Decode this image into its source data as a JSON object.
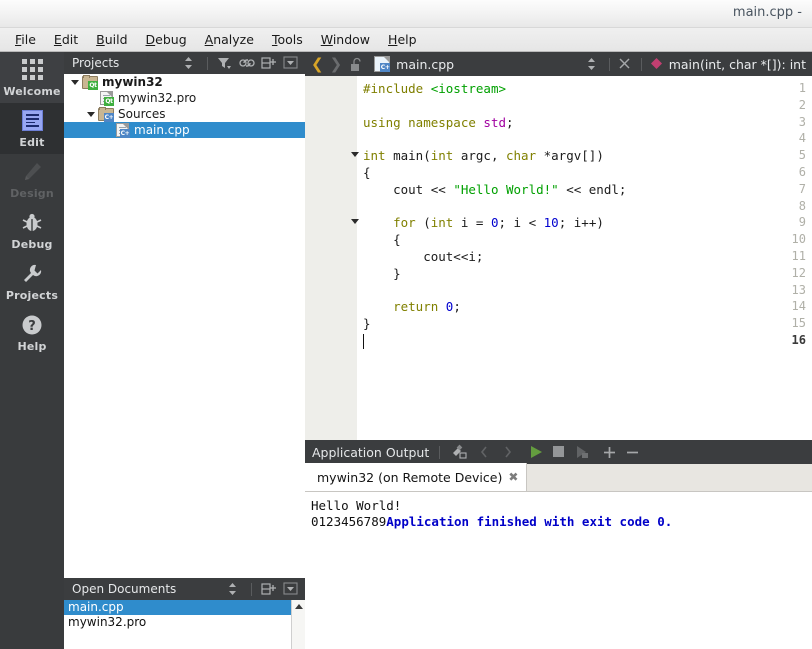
{
  "window": {
    "title": "main.cpp -"
  },
  "menubar": {
    "items": [
      {
        "label": "File",
        "mnemonic": "F"
      },
      {
        "label": "Edit",
        "mnemonic": "E"
      },
      {
        "label": "Build",
        "mnemonic": "B"
      },
      {
        "label": "Debug",
        "mnemonic": "D"
      },
      {
        "label": "Analyze",
        "mnemonic": "A"
      },
      {
        "label": "Tools",
        "mnemonic": "T"
      },
      {
        "label": "Window",
        "mnemonic": "W"
      },
      {
        "label": "Help",
        "mnemonic": "H"
      }
    ]
  },
  "modebar": {
    "items": [
      {
        "label": "Welcome",
        "icon": "grid-icon",
        "state": "normal"
      },
      {
        "label": "Edit",
        "icon": "document-edit-icon",
        "state": "active"
      },
      {
        "label": "Design",
        "icon": "pencil-icon",
        "state": "disabled"
      },
      {
        "label": "Debug",
        "icon": "bug-icon",
        "state": "normal"
      },
      {
        "label": "Projects",
        "icon": "wrench-icon",
        "state": "normal"
      },
      {
        "label": "Help",
        "icon": "question-mark-icon",
        "state": "normal"
      }
    ]
  },
  "projects_panel": {
    "title": "Projects",
    "tools": [
      "sort-selector-icon",
      "filter-icon",
      "link-icon",
      "split-add-icon",
      "close-dropdown-icon"
    ],
    "tree": [
      {
        "label": "mywin32",
        "icon": "qt-folder-icon",
        "depth": 0,
        "expanded": true,
        "bold": true,
        "selected": false
      },
      {
        "label": "mywin32.pro",
        "icon": "qt-file-icon",
        "depth": 1,
        "expanded": false,
        "bold": false,
        "selected": false
      },
      {
        "label": "Sources",
        "icon": "cpp-folder-icon",
        "depth": 1,
        "expanded": true,
        "bold": false,
        "selected": false
      },
      {
        "label": "main.cpp",
        "icon": "cpp-file-icon",
        "depth": 2,
        "expanded": false,
        "bold": false,
        "selected": true
      }
    ]
  },
  "open_documents": {
    "title": "Open Documents",
    "tools": [
      "sort-selector-icon",
      "split-add-icon",
      "close-dropdown-icon"
    ],
    "items": [
      {
        "label": "main.cpp",
        "selected": true
      },
      {
        "label": "mywin32.pro",
        "selected": false
      }
    ]
  },
  "editor_toolbar": {
    "back_icon": "chevron-left-icon",
    "forward_icon": "chevron-right-icon",
    "lock_icon": "unlocked-icon",
    "file_icon": "cpp-file-icon",
    "filename": "main.cpp",
    "selector_icon": "updown-selector-icon",
    "close_icon": "close-x-icon",
    "symbol_icon": "function-diamond-icon",
    "symbol": "main(int, char *[]): int"
  },
  "code": {
    "cursor_line": 16,
    "lines": [
      {
        "n": 1,
        "fold": false,
        "tokens": [
          {
            "t": "#include ",
            "c": "pre"
          },
          {
            "t": "<iostream>",
            "c": "str"
          }
        ]
      },
      {
        "n": 2,
        "fold": false,
        "tokens": []
      },
      {
        "n": 3,
        "fold": false,
        "tokens": [
          {
            "t": "using namespace ",
            "c": "kw"
          },
          {
            "t": "std",
            "c": "ns"
          },
          {
            "t": ";",
            "c": "op"
          }
        ]
      },
      {
        "n": 4,
        "fold": false,
        "tokens": []
      },
      {
        "n": 5,
        "fold": true,
        "tokens": [
          {
            "t": "int",
            "c": "kw"
          },
          {
            "t": " main(",
            "c": "op"
          },
          {
            "t": "int",
            "c": "kw"
          },
          {
            "t": " argc, ",
            "c": "op"
          },
          {
            "t": "char",
            "c": "kw"
          },
          {
            "t": " *argv[])",
            "c": "op"
          }
        ]
      },
      {
        "n": 6,
        "fold": false,
        "tokens": [
          {
            "t": "{",
            "c": "op"
          }
        ]
      },
      {
        "n": 7,
        "fold": false,
        "tokens": [
          {
            "t": "    cout << ",
            "c": "op"
          },
          {
            "t": "\"Hello World!\"",
            "c": "str"
          },
          {
            "t": " << endl;",
            "c": "op"
          }
        ]
      },
      {
        "n": 8,
        "fold": false,
        "tokens": []
      },
      {
        "n": 9,
        "fold": true,
        "tokens": [
          {
            "t": "    ",
            "c": "op"
          },
          {
            "t": "for",
            "c": "kw"
          },
          {
            "t": " (",
            "c": "op"
          },
          {
            "t": "int",
            "c": "kw"
          },
          {
            "t": " i = ",
            "c": "op"
          },
          {
            "t": "0",
            "c": "num"
          },
          {
            "t": "; i < ",
            "c": "op"
          },
          {
            "t": "10",
            "c": "num"
          },
          {
            "t": "; i++)",
            "c": "op"
          }
        ]
      },
      {
        "n": 10,
        "fold": false,
        "tokens": [
          {
            "t": "    {",
            "c": "op"
          }
        ]
      },
      {
        "n": 11,
        "fold": false,
        "tokens": [
          {
            "t": "        cout<<i;",
            "c": "op"
          }
        ]
      },
      {
        "n": 12,
        "fold": false,
        "tokens": [
          {
            "t": "    }",
            "c": "op"
          }
        ]
      },
      {
        "n": 13,
        "fold": false,
        "tokens": []
      },
      {
        "n": 14,
        "fold": false,
        "tokens": [
          {
            "t": "    ",
            "c": "op"
          },
          {
            "t": "return",
            "c": "kw"
          },
          {
            "t": " ",
            "c": "op"
          },
          {
            "t": "0",
            "c": "num"
          },
          {
            "t": ";",
            "c": "op"
          }
        ]
      },
      {
        "n": 15,
        "fold": false,
        "tokens": [
          {
            "t": "}",
            "c": "op"
          }
        ]
      },
      {
        "n": 16,
        "fold": false,
        "tokens": []
      }
    ]
  },
  "output_pane": {
    "title": "Application Output",
    "tools": [
      "clear-output-icon",
      "prev-item-icon",
      "next-item-icon",
      "run-icon",
      "stop-icon",
      "attach-icon",
      "zoom-in-icon",
      "zoom-out-icon"
    ],
    "tab": {
      "label": "mywin32 (on Remote Device)",
      "close_icon": "close-x-icon"
    },
    "lines": [
      {
        "segments": [
          {
            "t": "Hello World!",
            "c": "plain"
          }
        ]
      },
      {
        "segments": [
          {
            "t": "0123456789",
            "c": "plain"
          },
          {
            "t": "Application finished with exit code 0.",
            "c": "blue"
          }
        ]
      }
    ]
  },
  "colors": {
    "accent_selection": "#2f8ccc",
    "dark_chrome": "#3b3d3f",
    "mode_bar": "#393b3d",
    "gutter": "#eeeeea",
    "string_green": "#00a000",
    "keyword_olive": "#808000",
    "namespace_purple": "#a000a0",
    "number_blue": "#0000cf",
    "output_blue": "#0000c8",
    "run_green": "#6eb33f"
  }
}
